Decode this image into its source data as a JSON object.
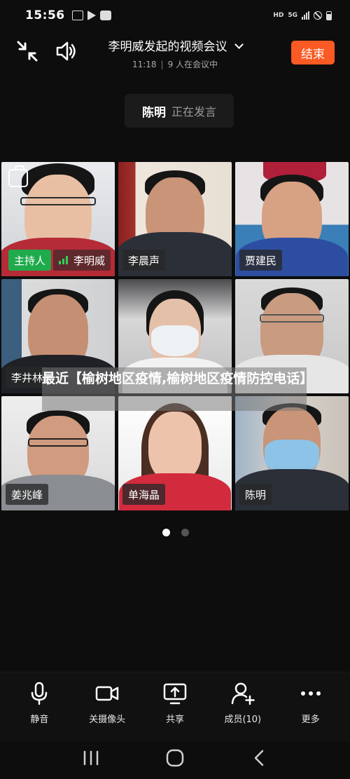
{
  "status_bar": {
    "time": "15:56",
    "network": "HD",
    "network_type": "5G"
  },
  "header": {
    "title": "李明威发起的视频会议",
    "duration": "11:18",
    "separator": "|",
    "participant_text": "9 人在会议中",
    "end_label": "结束",
    "end_color": "#fa5a23"
  },
  "speaking": {
    "name": "陈明",
    "status": "正在发言"
  },
  "participants": [
    {
      "name": "李明威",
      "host_label": "主持人"
    },
    {
      "name": "李晨声"
    },
    {
      "name": "贾建民"
    },
    {
      "name": "李井林"
    },
    {
      "name": ""
    },
    {
      "name": ""
    },
    {
      "name": "姜兆峰"
    },
    {
      "name": "单海晶"
    },
    {
      "name": "陈明"
    }
  ],
  "overlay": {
    "text": "最近【榆树地区疫情,榆树地区疫情防控电话】"
  },
  "pagination": {
    "current": 1,
    "total": 2
  },
  "toolbar": {
    "mute": "静音",
    "camera_off": "关摄像头",
    "share": "共享",
    "members": "成员(10)",
    "more": "更多"
  },
  "icons": [
    "minimize-icon",
    "speaker-icon",
    "chevron-down-icon",
    "switch-camera-icon",
    "mic-icon",
    "video-camera-icon",
    "share-screen-icon",
    "members-icon",
    "more-icon",
    "recents-icon",
    "home-icon",
    "back-icon"
  ],
  "colors": {
    "active_speaker": "#1ec45a",
    "host_badge": "#1fab4c"
  }
}
